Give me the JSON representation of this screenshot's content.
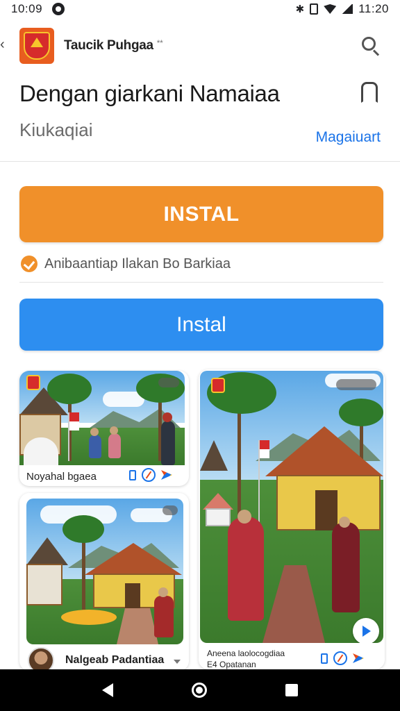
{
  "status_bar": {
    "time_left": "10:09",
    "time_right": "11:20"
  },
  "header": {
    "app_name": "Taucik Puhgaa",
    "app_name_suffix": "**"
  },
  "listing": {
    "title": "Dengan giarkani Namaiaa",
    "subtitle": "Kiukaqiai",
    "manage_link": "Magaiuart"
  },
  "actions": {
    "primary_label": "INSTAL",
    "verification_text": "Anibaantiap Ilakan Bo Barkiaa",
    "secondary_label": "Instal"
  },
  "screenshots": {
    "card1_caption": "Noyahal bgaea",
    "card2_caption": "Nalgeab Padantiaa",
    "card3_caption_line1": "Aneena laolocogdiaa",
    "card3_caption_line2": "E4 Opatanan"
  },
  "colors": {
    "primary_button": "#f0902a",
    "secondary_button": "#2d8ef0",
    "link": "#1a73e8"
  }
}
